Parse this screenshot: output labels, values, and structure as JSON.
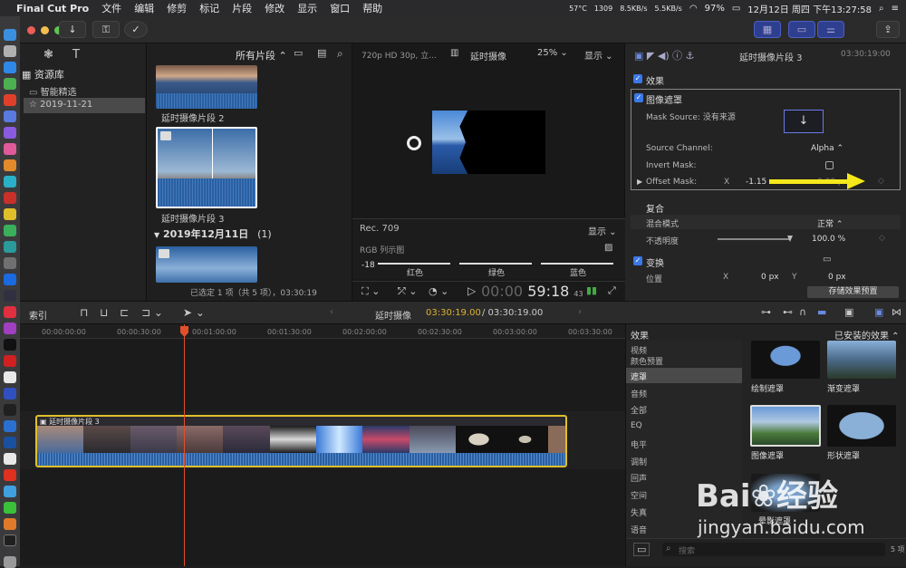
{
  "menubar": {
    "app_name": "Final Cut Pro",
    "items": [
      "文件",
      "编辑",
      "修剪",
      "标记",
      "片段",
      "修改",
      "显示",
      "窗口",
      "帮助"
    ],
    "network": "8.5KB/s",
    "network2": "5.5KB/s",
    "temp": "57°C",
    "rpm": "1309",
    "battery": "97%",
    "clock": "12月12日 周四 下午13:27:58"
  },
  "library": {
    "title": "资源库",
    "items": [
      "智能精选",
      "2019-11-21"
    ]
  },
  "browser": {
    "filter": "所有片段 ⌃",
    "clips": [
      {
        "label": "延时摄像片段 2"
      },
      {
        "label": "延时摄像片段 3"
      }
    ],
    "date_header": "2019年12月11日",
    "date_count": "(1)",
    "status": "已选定 1 项（共 5 项），03:30:19"
  },
  "viewer": {
    "format": "720p HD 30p, 立...",
    "title": "延时摄像",
    "zoom": "25%",
    "display": "显示",
    "scope_label": "Rec. 709",
    "scope_display": "显示",
    "scope_title": "RGB 列示图",
    "scope_minus": "-18",
    "channels": [
      "红色",
      "绿色",
      "蓝色"
    ],
    "timecode": "59:18",
    "timecode_frames": "43"
  },
  "inspector": {
    "title": "延时摄像片段 3",
    "duration": "03:30:19:00",
    "effects_label": "效果",
    "mask_title": "图像遮罩",
    "mask_source_label": "Mask Source:",
    "mask_source_value": "没有来源",
    "channel_label": "Source Channel:",
    "channel_value": "Alpha ⌃",
    "invert_label": "Invert Mask:",
    "offset_label": "Offset Mask:",
    "offset_x": "X",
    "offset_x_value": "-1.15",
    "offset_y_value": "0.00 px",
    "composite_label": "复合",
    "blend_label": "混合模式",
    "blend_value": "正常 ⌃",
    "opacity_label": "不透明度",
    "opacity_value": "100.0 %",
    "opacity": 1.0,
    "transform_label": "变换",
    "position_label": "位置",
    "pos_x": "X",
    "pos_x_value": "0 px",
    "pos_y": "Y",
    "pos_y_value": "0 px",
    "save_preset": "存储效果预置"
  },
  "timeline_bar": {
    "index": "索引",
    "project": "延时摄像",
    "current": "03:30:19.00",
    "total": "/ 03:30:19.00"
  },
  "ruler": [
    "00:00:00:00",
    "00:00:30:00",
    "00:01:00:00",
    "00:01:30:00",
    "00:02:00:00",
    "00:02:30:00",
    "00:03:00:00",
    "00:03:30:00"
  ],
  "clip_name": "延时摄像片段 3",
  "effects_browser": {
    "title": "效果",
    "installed": "已安装的效果 ⌃",
    "categories": [
      "视频",
      "颜色预置",
      "遮罩",
      "音频",
      "全部",
      "EQ",
      "电平",
      "调制",
      "回声",
      "空间",
      "失真",
      "语音"
    ],
    "selected": "遮罩",
    "items": [
      "绘制遮罩",
      "渐变遮罩",
      "图像遮罩",
      "形状遮罩",
      "晕影遮罩"
    ],
    "search_placeholder": "搜索",
    "count": "5 项"
  },
  "watermark": {
    "line1": "Bai",
    "line2": "经验",
    "url": "jingyan.baidu.com"
  },
  "colors": {
    "accent": "#3a78e8",
    "yellow_clip": "#e0c02a",
    "playhead": "#e0502a",
    "timecode_yellow": "#e0b030"
  }
}
